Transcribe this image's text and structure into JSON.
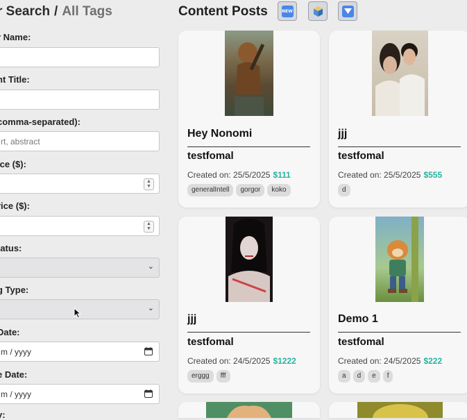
{
  "sidebar": {
    "title_part1": "r Search",
    "separator": "/",
    "title_part2": "All Tags",
    "fields": {
      "name_label": "r Name:",
      "title_label": "nt Title:",
      "tags_label": "comma-separated):",
      "tags_placeholder": "rt, abstract",
      "min_price_label": "ice ($):",
      "max_price_label": "rice ($):",
      "status_label": "tatus:",
      "type_label": "g Type:",
      "start_date_label": "Date:",
      "start_date_value": "m / yyyy",
      "end_date_label": "e Date:",
      "end_date_value": "m / yyyy",
      "last_label": "y:"
    }
  },
  "main": {
    "title": "Content Posts",
    "toolbar": [
      "new-badge-icon",
      "cube-icon",
      "dropdown-arrow-icon"
    ]
  },
  "posts": [
    {
      "title": "Hey Nonomi",
      "subtitle": "testfomal",
      "date_label": "Created on: 25/5/2025",
      "price": "$111",
      "tags": [
        "generalIntell",
        "gorgor",
        "koko"
      ]
    },
    {
      "title": "jjj",
      "subtitle": "testfomal",
      "date_label": "Created on: 25/5/2025",
      "price": "$555",
      "tags": [
        "d"
      ]
    },
    {
      "title": "jjj",
      "subtitle": "testfomal",
      "date_label": "Created on: 24/5/2025",
      "price": "$1222",
      "tags": [
        "erggg",
        "fff"
      ]
    },
    {
      "title": "Demo 1",
      "subtitle": "testfomal",
      "date_label": "Created on: 24/5/2025",
      "price": "$222",
      "tags": [
        "a",
        "d",
        "e",
        "f"
      ]
    }
  ],
  "colors": {
    "price": "#27b3a0",
    "card": "#f7f7f7"
  }
}
